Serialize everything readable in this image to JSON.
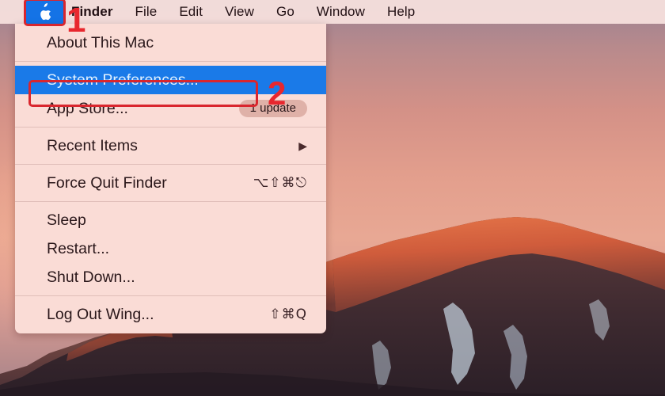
{
  "menubar": {
    "apple_logo_icon": "apple-logo-icon",
    "items": [
      {
        "label": "Finder",
        "bold": true
      },
      {
        "label": "File",
        "bold": false
      },
      {
        "label": "Edit",
        "bold": false
      },
      {
        "label": "View",
        "bold": false
      },
      {
        "label": "Go",
        "bold": false
      },
      {
        "label": "Window",
        "bold": false
      },
      {
        "label": "Help",
        "bold": false
      }
    ]
  },
  "apple_menu": {
    "about": {
      "label": "About This Mac"
    },
    "system_preferences": {
      "label": "System Preferences...",
      "selected": true
    },
    "app_store": {
      "label": "App Store...",
      "badge": "1 update"
    },
    "recent_items": {
      "label": "Recent Items",
      "submenu_arrow": "▶"
    },
    "force_quit": {
      "label": "Force Quit Finder",
      "accel": "⌥⇧⌘⎋"
    },
    "sleep": {
      "label": "Sleep"
    },
    "restart": {
      "label": "Restart..."
    },
    "shut_down": {
      "label": "Shut Down..."
    },
    "log_out": {
      "label": "Log Out Wing...",
      "accel": "⇧⌘Q"
    }
  },
  "annotations": {
    "step_one": "1",
    "step_two": "2",
    "color": "#d9262e"
  },
  "colors": {
    "menu_background": "#fadcd6",
    "menubar_background": "#f8e2df",
    "highlight_blue": "#1a7ae8",
    "apple_cell_blue": "#1473e6",
    "annotation_red": "#d9262e"
  }
}
